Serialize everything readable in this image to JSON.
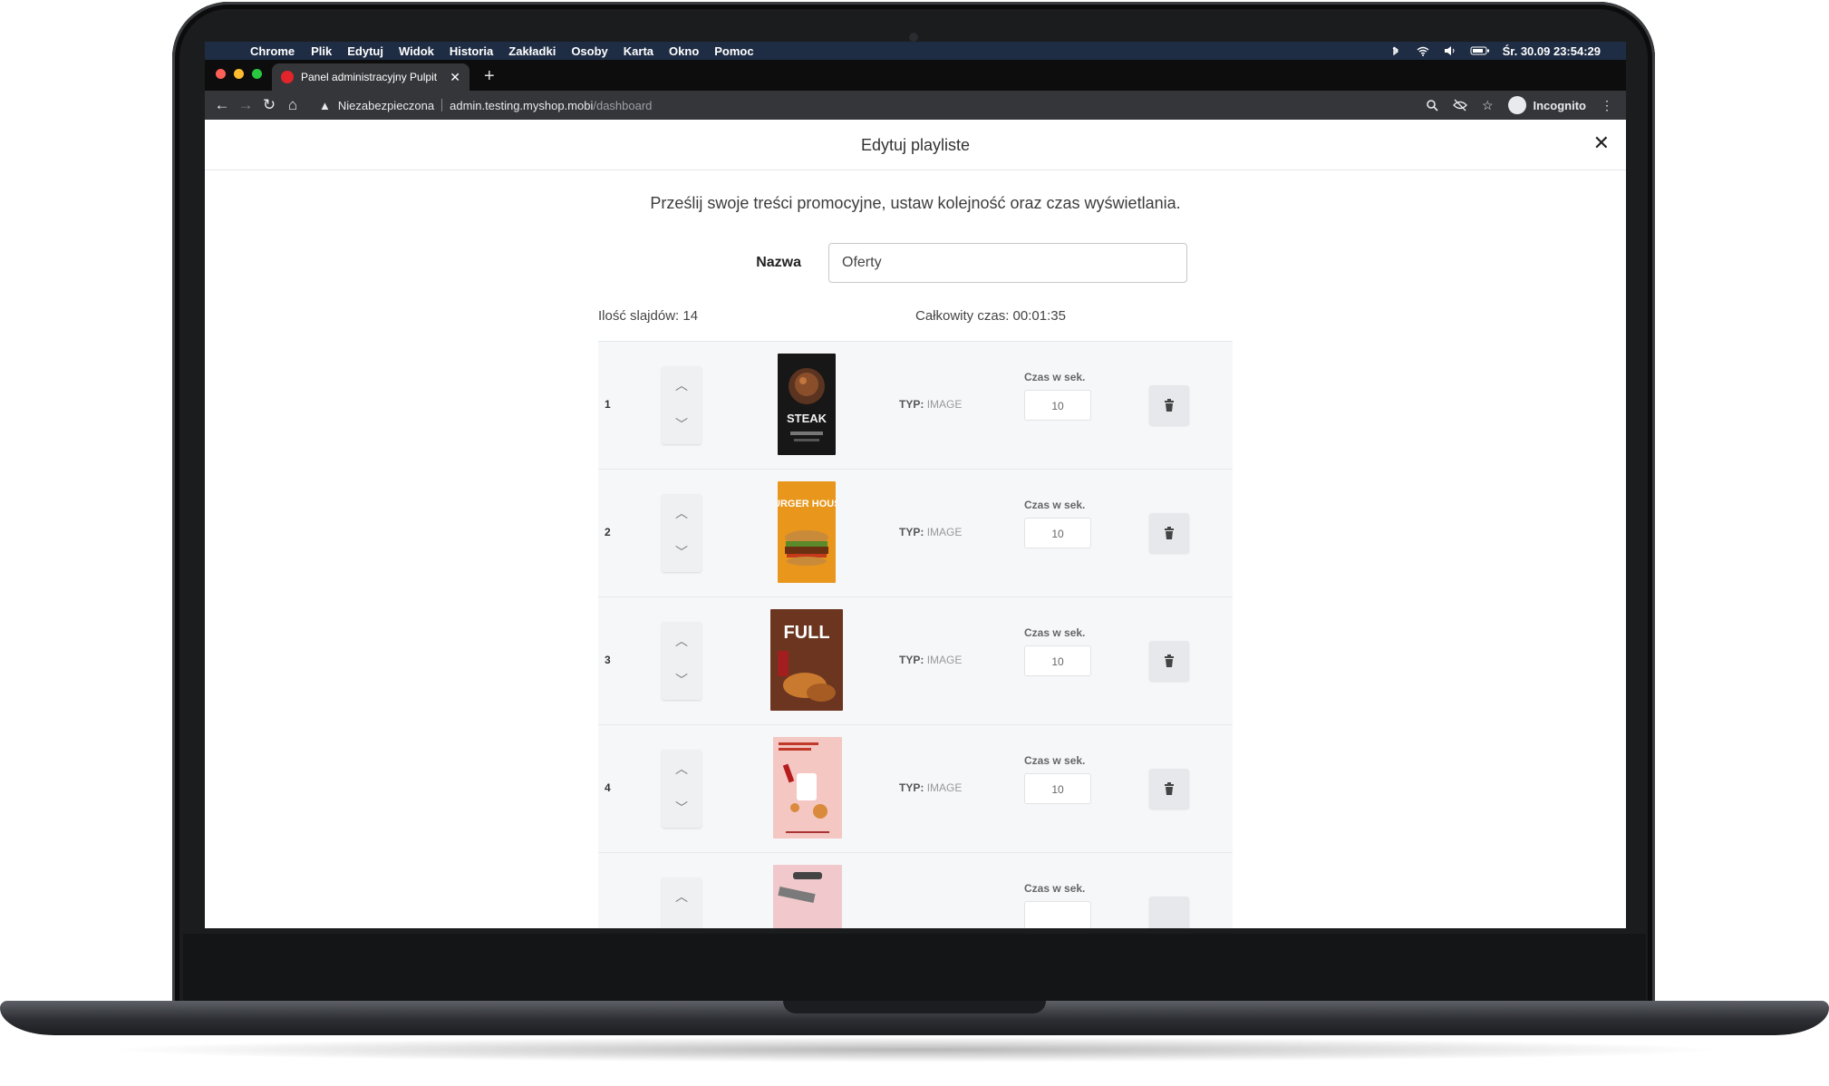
{
  "menubar": {
    "app": "Chrome",
    "items": [
      "Plik",
      "Edytuj",
      "Widok",
      "Historia",
      "Zakładki",
      "Osoby",
      "Karta",
      "Okno",
      "Pomoc"
    ],
    "clock": "Śr. 30.09  23:54:29"
  },
  "browser": {
    "tab_title": "Panel administracyjny Pulpit",
    "security_label": "Niezabezpieczona",
    "url_host": "admin.testing.myshop.mobi",
    "url_path": "/dashboard",
    "profile_label": "Incognito"
  },
  "modal": {
    "title": "Edytuj playliste",
    "intro": "Prześlij swoje treści promocyjne, ustaw kolejność oraz czas wyświetlania.",
    "name_label": "Nazwa",
    "name_value": "Oferty",
    "slide_count": "Ilość slajdów: 14",
    "total_time": "Całkowity czas: 00:01:35"
  },
  "slides": [
    {
      "index": "1",
      "type_key": "TYP:",
      "type_value": "IMAGE",
      "time_label": "Czas w sek.",
      "time_value": "10",
      "thumb_text": "STEAK"
    },
    {
      "index": "2",
      "type_key": "TYP:",
      "type_value": "IMAGE",
      "time_label": "Czas w sek.",
      "time_value": "10",
      "thumb_text": "BURGER HOUSE"
    },
    {
      "index": "3",
      "type_key": "TYP:",
      "type_value": "IMAGE",
      "time_label": "Czas w sek.",
      "time_value": "10",
      "thumb_text": "FULL"
    },
    {
      "index": "4",
      "type_key": "TYP:",
      "type_value": "IMAGE",
      "time_label": "Czas w sek.",
      "time_value": "10",
      "thumb_text": ""
    },
    {
      "index": "",
      "type_key": "",
      "type_value": "",
      "time_label": "Czas w sek.",
      "time_value": "",
      "thumb_text": ""
    }
  ],
  "icons": {
    "move_up": "chevron-up-icon",
    "move_down": "chevron-down-icon",
    "delete": "trash-icon",
    "close": "close-icon"
  }
}
